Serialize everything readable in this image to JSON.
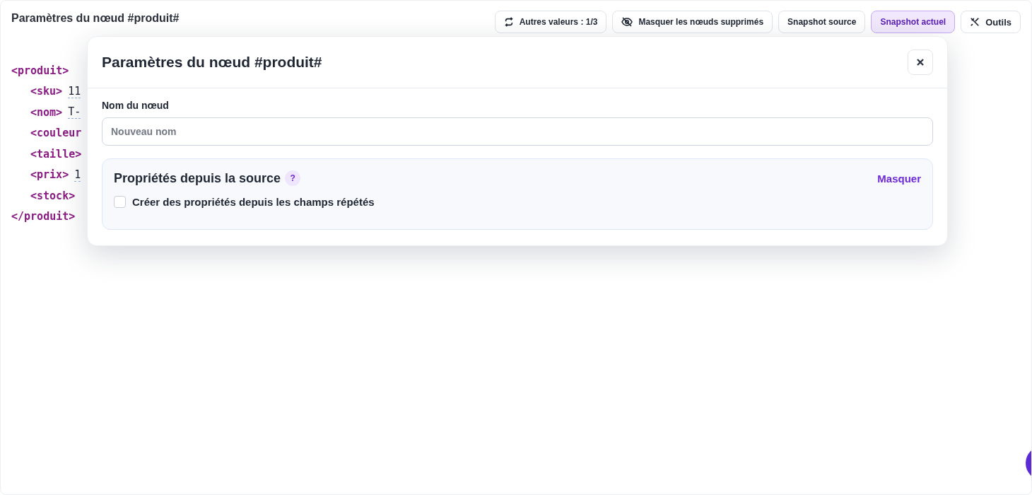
{
  "page": {
    "title": "Paramètres du nœud #produit#"
  },
  "toolbar": {
    "actions": [
      {
        "label": "Autres valeurs : 1/3",
        "kind": "cycle"
      },
      {
        "label": "Masquer les nœuds supprimés",
        "kind": "hide"
      }
    ],
    "snapshots": [
      {
        "label": "Snapshot source",
        "selected": false
      },
      {
        "label": "Snapshot actuel",
        "selected": true
      }
    ],
    "tools": {
      "label": "Outils"
    }
  },
  "code_lines": [
    {
      "tag": "<produit>",
      "children": [
        {
          "tag": "<sku>",
          "value": "11"
        },
        {
          "tag": "<nom>",
          "value": "T-"
        },
        {
          "tag": "<couleur"
        },
        {
          "tag": "<taille>"
        },
        {
          "tag": "<prix>",
          "value": "1"
        },
        {
          "tag": "<stock>"
        }
      ]
    },
    {
      "tag": "</produit>"
    }
  ],
  "dialog": {
    "title": "Paramètres du nœud #produit#",
    "name_field": {
      "label": "Nom du nœud",
      "placeholder": "Nouveau nom"
    },
    "section": {
      "title": "Propriétés depuis la source",
      "help": "?",
      "toggle": "Masquer",
      "option": {
        "label": "Créer des propriétés depuis les champs répétés",
        "checked": false
      }
    }
  }
}
